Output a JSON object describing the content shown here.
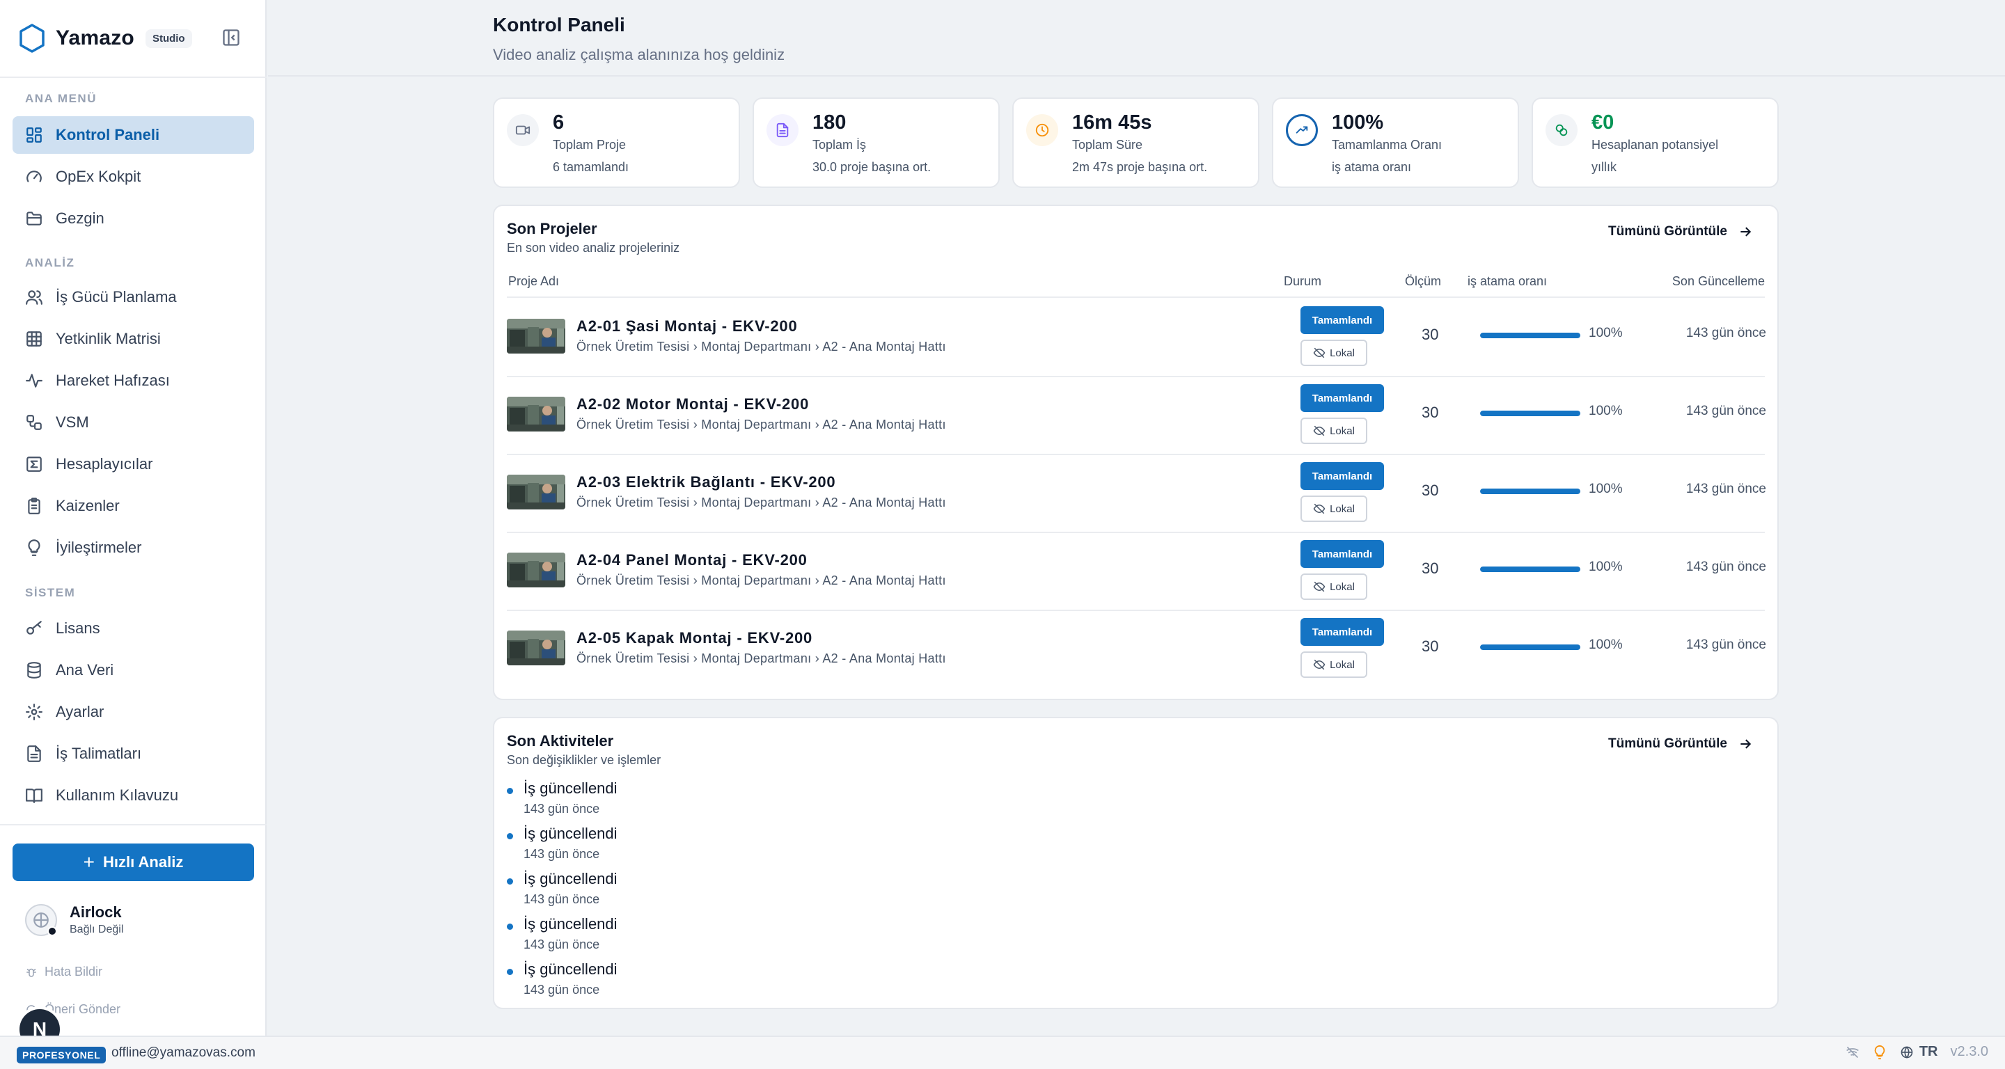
{
  "brand": {
    "name": "Yamazo",
    "tag": "Studio"
  },
  "sidebar": {
    "sections": {
      "main": "ANA MENÜ",
      "analysis": "ANALİZ",
      "system": "SİSTEM"
    },
    "main_items": [
      {
        "label": "Kontrol Paneli",
        "icon": "dashboard-icon"
      },
      {
        "label": "OpEx Kokpit",
        "icon": "gauge-icon"
      },
      {
        "label": "Gezgin",
        "icon": "folder-icon"
      }
    ],
    "analysis_items": [
      {
        "label": "İş Gücü Planlama",
        "icon": "users-icon"
      },
      {
        "label": "Yetkinlik Matrisi",
        "icon": "grid-icon"
      },
      {
        "label": "Hareket Hafızası",
        "icon": "activity-icon"
      },
      {
        "label": "VSM",
        "icon": "workflow-icon"
      },
      {
        "label": "Hesaplayıcılar",
        "icon": "sigma-icon"
      },
      {
        "label": "Kaizenler",
        "icon": "clipboard-icon"
      },
      {
        "label": "İyileştirmeler",
        "icon": "lightbulb-icon"
      }
    ],
    "system_items": [
      {
        "label": "Lisans",
        "icon": "key-icon"
      },
      {
        "label": "Ana Veri",
        "icon": "database-icon"
      },
      {
        "label": "Ayarlar",
        "icon": "gear-icon"
      },
      {
        "label": "İş Talimatları",
        "icon": "file-text-icon"
      },
      {
        "label": "Kullanım Kılavuzu",
        "icon": "book-icon"
      }
    ],
    "quick_analysis": "Hızlı Analiz",
    "airlock": {
      "title": "Airlock",
      "status": "Bağlı Değil"
    },
    "report_bug": "Hata Bildir",
    "suggest": "Öneri Gönder",
    "n_badge": "N"
  },
  "bottom_bar": {
    "plan": "PROFESYONEL",
    "email": "offline@yamazovas.com",
    "lang": "TR",
    "version": "v2.3.0"
  },
  "header": {
    "title": "Kontrol Paneli",
    "subtitle": "Video analiz çalışma alanınıza hoş geldiniz"
  },
  "stats": [
    {
      "value": "6",
      "label": "Toplam Proje",
      "sub": "6 tamamlandı",
      "color": "#667085",
      "bg": "#f2f4f7",
      "icon": "video-icon"
    },
    {
      "value": "180",
      "label": "Toplam İş",
      "sub": "30.0 proje başına ort.",
      "color": "#7a5af8",
      "bg": "#f4f3ff",
      "icon": "document-icon"
    },
    {
      "value": "16m 45s",
      "label": "Toplam Süre",
      "sub": "2m 47s proje başına ort.",
      "color": "#f79009",
      "bg": "#fef6e7",
      "icon": "clock-icon"
    },
    {
      "value": "100%",
      "label": "Tamamlanma Oranı",
      "sub": "iş atama oranı",
      "color": "#1664b0",
      "bg": "#ffffff",
      "icon": "trending-up-icon"
    },
    {
      "value": "€0",
      "label": "Hesaplanan potansiyel",
      "sub": "yıllık",
      "color": "#079455",
      "bg": "#f2f4f7",
      "icon": "coins-icon"
    }
  ],
  "projects": {
    "title": "Son Projeler",
    "subtitle": "En son video analiz projeleriniz",
    "view_all": "Tümünü Görüntüle",
    "columns": {
      "name": "Proje Adı",
      "status": "Durum",
      "measure": "Ölçüm",
      "rate": "iş atama oranı",
      "updated": "Son Güncelleme"
    },
    "rows": [
      {
        "name": "A2-01 Şasi Montaj - EKV-200",
        "path": "Örnek Üretim Tesisi › Montaj Departmanı › A2 - Ana Montaj Hattı",
        "status": "Tamamlandı",
        "storage": "Lokal",
        "measure": "30",
        "progress": 1.0,
        "pct": "100%",
        "updated": "143 gün önce"
      },
      {
        "name": "A2-02 Motor Montaj - EKV-200",
        "path": "Örnek Üretim Tesisi › Montaj Departmanı › A2 - Ana Montaj Hattı",
        "status": "Tamamlandı",
        "storage": "Lokal",
        "measure": "30",
        "progress": 1.0,
        "pct": "100%",
        "updated": "143 gün önce"
      },
      {
        "name": "A2-03 Elektrik Bağlantı - EKV-200",
        "path": "Örnek Üretim Tesisi › Montaj Departmanı › A2 - Ana Montaj Hattı",
        "status": "Tamamlandı",
        "storage": "Lokal",
        "measure": "30",
        "progress": 1.0,
        "pct": "100%",
        "updated": "143 gün önce"
      },
      {
        "name": "A2-04 Panel Montaj - EKV-200",
        "path": "Örnek Üretim Tesisi › Montaj Departmanı › A2 - Ana Montaj Hattı",
        "status": "Tamamlandı",
        "storage": "Lokal",
        "measure": "30",
        "progress": 1.0,
        "pct": "100%",
        "updated": "143 gün önce"
      },
      {
        "name": "A2-05 Kapak Montaj - EKV-200",
        "path": "Örnek Üretim Tesisi › Montaj Departmanı › A2 - Ana Montaj Hattı",
        "status": "Tamamlandı",
        "storage": "Lokal",
        "measure": "30",
        "progress": 1.0,
        "pct": "100%",
        "updated": "143 gün önce"
      }
    ]
  },
  "activities": {
    "title": "Son Aktiviteler",
    "subtitle": "Son değişiklikler ve işlemler",
    "view_all": "Tümünü Görüntüle",
    "items": [
      {
        "text": "İş güncellendi",
        "when": "143 gün önce"
      },
      {
        "text": "İş güncellendi",
        "when": "143 gün önce"
      },
      {
        "text": "İş güncellendi",
        "when": "143 gün önce"
      },
      {
        "text": "İş güncellendi",
        "when": "143 gün önce"
      },
      {
        "text": "İş güncellendi",
        "when": "143 gün önce"
      }
    ]
  }
}
